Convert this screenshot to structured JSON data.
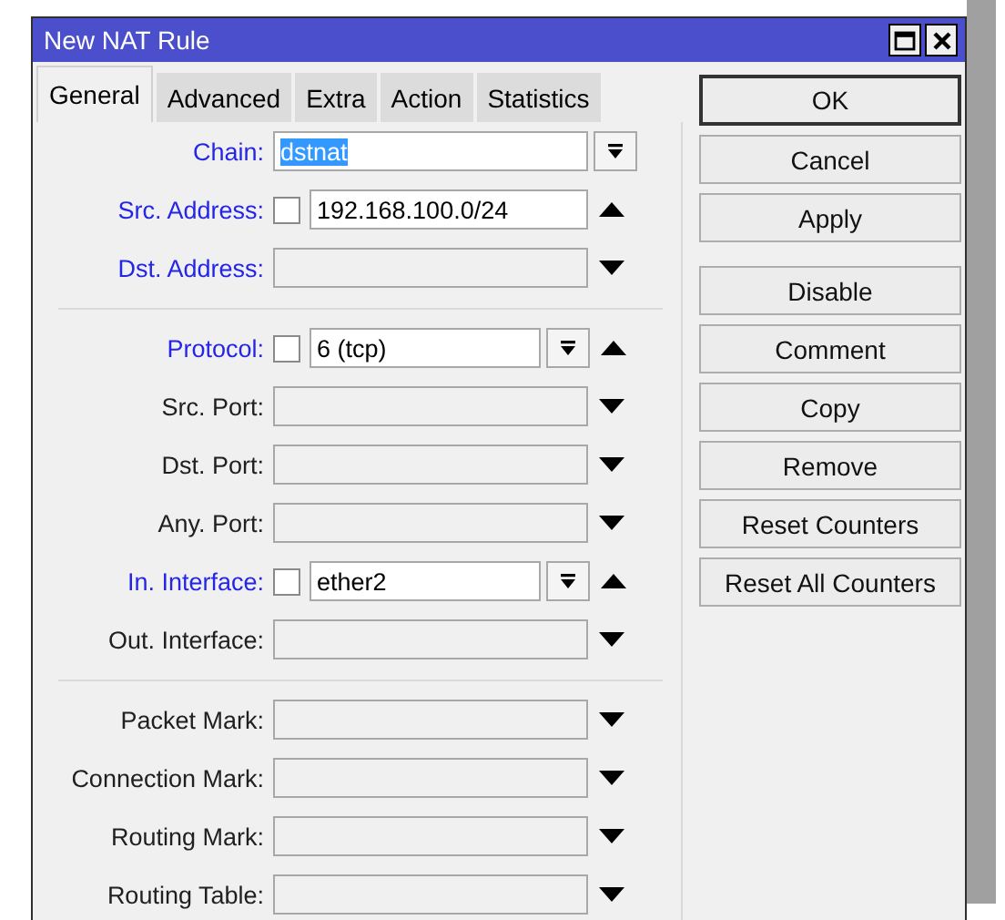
{
  "window": {
    "title": "New NAT Rule"
  },
  "tabs": [
    {
      "label": "General",
      "selected": true
    },
    {
      "label": "Advanced",
      "selected": false
    },
    {
      "label": "Extra",
      "selected": false
    },
    {
      "label": "Action",
      "selected": false
    },
    {
      "label": "Statistics",
      "selected": false
    }
  ],
  "sections": [
    {
      "rows": [
        {
          "kind": "select",
          "label": "Chain:",
          "active": true,
          "value": "dstnat",
          "value_selected": true
        },
        {
          "kind": "filter",
          "label": "Src. Address:",
          "active": true,
          "expanded": true,
          "checked": false,
          "value": "192.168.100.0/24",
          "dropdown": false
        },
        {
          "kind": "filter",
          "label": "Dst. Address:",
          "active": true,
          "expanded": false
        }
      ]
    },
    {
      "rows": [
        {
          "kind": "filter",
          "label": "Protocol:",
          "active": true,
          "expanded": true,
          "checked": false,
          "value": "6 (tcp)",
          "dropdown": true
        },
        {
          "kind": "filter",
          "label": "Src. Port:",
          "active": false,
          "expanded": false
        },
        {
          "kind": "filter",
          "label": "Dst. Port:",
          "active": false,
          "expanded": false
        },
        {
          "kind": "filter",
          "label": "Any. Port:",
          "active": false,
          "expanded": false
        },
        {
          "kind": "filter",
          "label": "In. Interface:",
          "active": true,
          "expanded": true,
          "checked": false,
          "value": "ether2",
          "dropdown": true
        },
        {
          "kind": "filter",
          "label": "Out. Interface:",
          "active": false,
          "expanded": false
        }
      ]
    },
    {
      "rows": [
        {
          "kind": "filter",
          "label": "Packet Mark:",
          "active": false,
          "expanded": false
        },
        {
          "kind": "filter",
          "label": "Connection Mark:",
          "active": false,
          "expanded": false
        },
        {
          "kind": "filter",
          "label": "Routing Mark:",
          "active": false,
          "expanded": false
        },
        {
          "kind": "filter",
          "label": "Routing Table:",
          "active": false,
          "expanded": false
        }
      ]
    }
  ],
  "primary_buttons": [
    {
      "label": "OK",
      "default": true
    },
    {
      "label": "Cancel",
      "default": false
    },
    {
      "label": "Apply",
      "default": false
    }
  ],
  "action_buttons": [
    {
      "label": "Disable"
    },
    {
      "label": "Comment"
    },
    {
      "label": "Copy"
    },
    {
      "label": "Remove"
    },
    {
      "label": "Reset Counters"
    },
    {
      "label": "Reset All Counters"
    }
  ]
}
